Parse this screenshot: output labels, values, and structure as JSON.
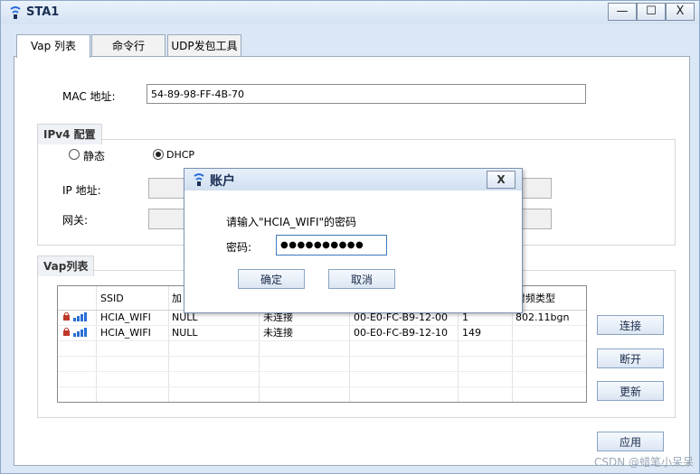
{
  "window": {
    "title": "STA1",
    "minimize": "—",
    "maximize": "☐",
    "close": "X"
  },
  "tabs": [
    {
      "label": "Vap 列表"
    },
    {
      "label": "命令行"
    },
    {
      "label": "UDP发包工具"
    }
  ],
  "mac": {
    "label": "MAC 地址:",
    "value": "54-89-98-FF-4B-70"
  },
  "ipv4": {
    "title": "IPv4 配置",
    "static_label": "静态",
    "dhcp_label": "DHCP",
    "selected": "DHCP",
    "ip_label": "IP 地址:",
    "gateway_label": "网关:"
  },
  "vap": {
    "title": "Vap列表",
    "columns": [
      "",
      "SSID",
      "加",
      "",
      "",
      "",
      "射频类型"
    ],
    "rows": [
      {
        "ssid": "HCIA_WIFI",
        "enc": "NULL",
        "status": "未连接",
        "bssid": "00-E0-FC-B9-12-00",
        "channel": "1",
        "radio": "802.11bgn"
      },
      {
        "ssid": "HCIA_WIFI",
        "enc": "NULL",
        "status": "未连接",
        "bssid": "00-E0-FC-B9-12-10",
        "channel": "149",
        "radio": ""
      }
    ],
    "connect": "连接",
    "disconnect": "断开",
    "refresh": "更新"
  },
  "apply": "应用",
  "dialog": {
    "title": "账户",
    "close": "X",
    "prompt": "请输入\"HCIA_WIFI\"的密码",
    "password_label": "密码:",
    "password_value": "●●●●●●●●●●",
    "ok": "确定",
    "cancel": "取消"
  },
  "watermark": "CSDN @蜡笔小呆呆",
  "colors": {
    "accent": "#1b2f55",
    "signal": "#2a6fd6",
    "lock": "#c0392b"
  }
}
